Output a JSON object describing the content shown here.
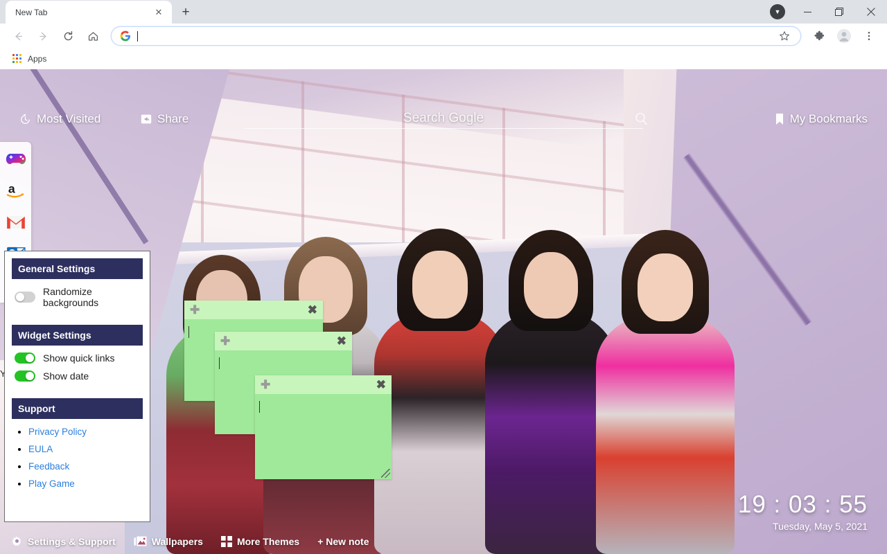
{
  "browser": {
    "tab": {
      "title": "New Tab",
      "close_icon": "close-icon"
    },
    "new_tab_icon": "plus-icon",
    "window_controls": {
      "dropdown_icon": "chevron-down-circle-icon",
      "minimize": "—",
      "maximize": "❐",
      "close": "✕"
    },
    "toolbar": {
      "back_icon": "arrow-left-icon",
      "forward_icon": "arrow-right-icon",
      "reload_icon": "reload-icon",
      "home_icon": "home-icon",
      "omnibox_value": "",
      "omnibox_placeholder": "",
      "star_icon": "star-outline-icon",
      "extensions_icon": "puzzle-piece-icon",
      "profile_icon": "avatar-icon",
      "menu_icon": "three-dot-menu-icon"
    },
    "bookmarks_bar": {
      "apps_label": "Apps",
      "apps_icon": "apps-grid-icon"
    }
  },
  "newtab": {
    "topnav": {
      "most_visited": {
        "label": "Most Visited",
        "icon": "history-icon"
      },
      "share": {
        "label": "Share",
        "icon": "share-icon"
      },
      "bookmarks": {
        "label": "My Bookmarks",
        "icon": "bookmark-icon"
      },
      "search": {
        "placeholder": "Search Gogle",
        "value": "",
        "icon": "magnifier-icon"
      }
    },
    "quicklinks": [
      {
        "name": "game-controller",
        "label": "Play Game"
      },
      {
        "name": "amazon",
        "label": "Amazon"
      },
      {
        "name": "gmail",
        "label": "Gmail"
      },
      {
        "name": "outlook",
        "label": "Outlook"
      },
      {
        "name": "yahoo",
        "label": "Yahoo"
      }
    ],
    "quicklink_hidden_text": "Y",
    "clock": {
      "time": "19 : 03 : 55",
      "date": "Tuesday, May 5, 2021"
    },
    "bottombar": [
      {
        "label": "Settings & Support",
        "icon": "gear-icon"
      },
      {
        "label": "Wallpapers",
        "icon": "image-icon"
      },
      {
        "label": "More Themes",
        "icon": "grid-icon"
      },
      {
        "label": "+ New note",
        "icon": "plus-icon"
      }
    ],
    "notes": [
      {
        "add_icon": "plus-icon",
        "close_icon": "close-x-icon",
        "text": "",
        "resize_icon": "resize-handle-icon"
      },
      {
        "add_icon": "plus-icon",
        "close_icon": "close-x-icon",
        "text": "",
        "resize_icon": "resize-handle-icon"
      },
      {
        "add_icon": "plus-icon",
        "close_icon": "close-x-icon",
        "text": "",
        "resize_icon": "resize-handle-icon"
      }
    ]
  },
  "settings_panel": {
    "general": {
      "header": "General Settings",
      "randomize": {
        "label": "Randomize backgrounds",
        "state": "off"
      }
    },
    "widget": {
      "header": "Widget Settings",
      "quick_links": {
        "label": "Show quick links",
        "state": "on"
      },
      "show_date": {
        "label": "Show date",
        "state": "on"
      }
    },
    "support": {
      "header": "Support",
      "links": [
        "Privacy Policy",
        "EULA",
        "Feedback",
        "Play Game"
      ]
    }
  },
  "colors": {
    "header_navy": "#2d2f5e",
    "toggle_on": "#24c324",
    "toggle_off": "#d2d2d2",
    "link_blue": "#2a7fe0",
    "note_body": "#a0e89a",
    "note_header": "#c8f5bc"
  }
}
